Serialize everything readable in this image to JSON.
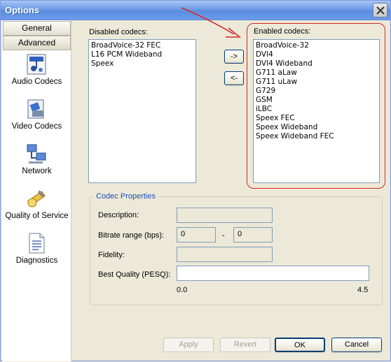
{
  "window": {
    "title": "Options"
  },
  "nav": {
    "tabs": [
      {
        "label": "General"
      },
      {
        "label": "Advanced"
      }
    ],
    "items": [
      {
        "label": "Audio Codecs",
        "icon": "audio-codecs-icon"
      },
      {
        "label": "Video Codecs",
        "icon": "video-codecs-icon"
      },
      {
        "label": "Network",
        "icon": "network-icon"
      },
      {
        "label": "Quality of Service",
        "icon": "quality-of-service-icon"
      },
      {
        "label": "Diagnostics",
        "icon": "diagnostics-icon"
      }
    ]
  },
  "codecs": {
    "disabled_label": "Disabled codecs:",
    "enabled_label": "Enabled codecs:",
    "disabled": [
      "BroadVoice-32 FEC",
      "L16 PCM Wideband",
      "Speex"
    ],
    "enabled": [
      "BroadVoice-32",
      "DVI4",
      "DVI4 Wideband",
      "G711 aLaw",
      "G711 uLaw",
      "G729",
      "GSM",
      "iLBC",
      "Speex FEC",
      "Speex Wideband",
      "Speex Wideband FEC"
    ],
    "move_right_label": "->",
    "move_left_label": "<-"
  },
  "properties": {
    "title": "Codec Properties",
    "description_label": "Description:",
    "description_value": "",
    "bitrate_label": "Bitrate range (bps):",
    "bitrate_min": "0",
    "bitrate_sep": "-",
    "bitrate_max": "0",
    "fidelity_label": "Fidelity:",
    "fidelity_value": "",
    "pesq_label": "Best Quality (PESQ):",
    "pesq_value": "",
    "pesq_min": "0.0",
    "pesq_max": "4.5"
  },
  "buttons": {
    "apply": "Apply",
    "revert": "Revert",
    "ok": "OK",
    "cancel": "Cancel"
  },
  "colors": {
    "highlight_annotation": "#d62828",
    "group_title": "#1f4fb5"
  }
}
